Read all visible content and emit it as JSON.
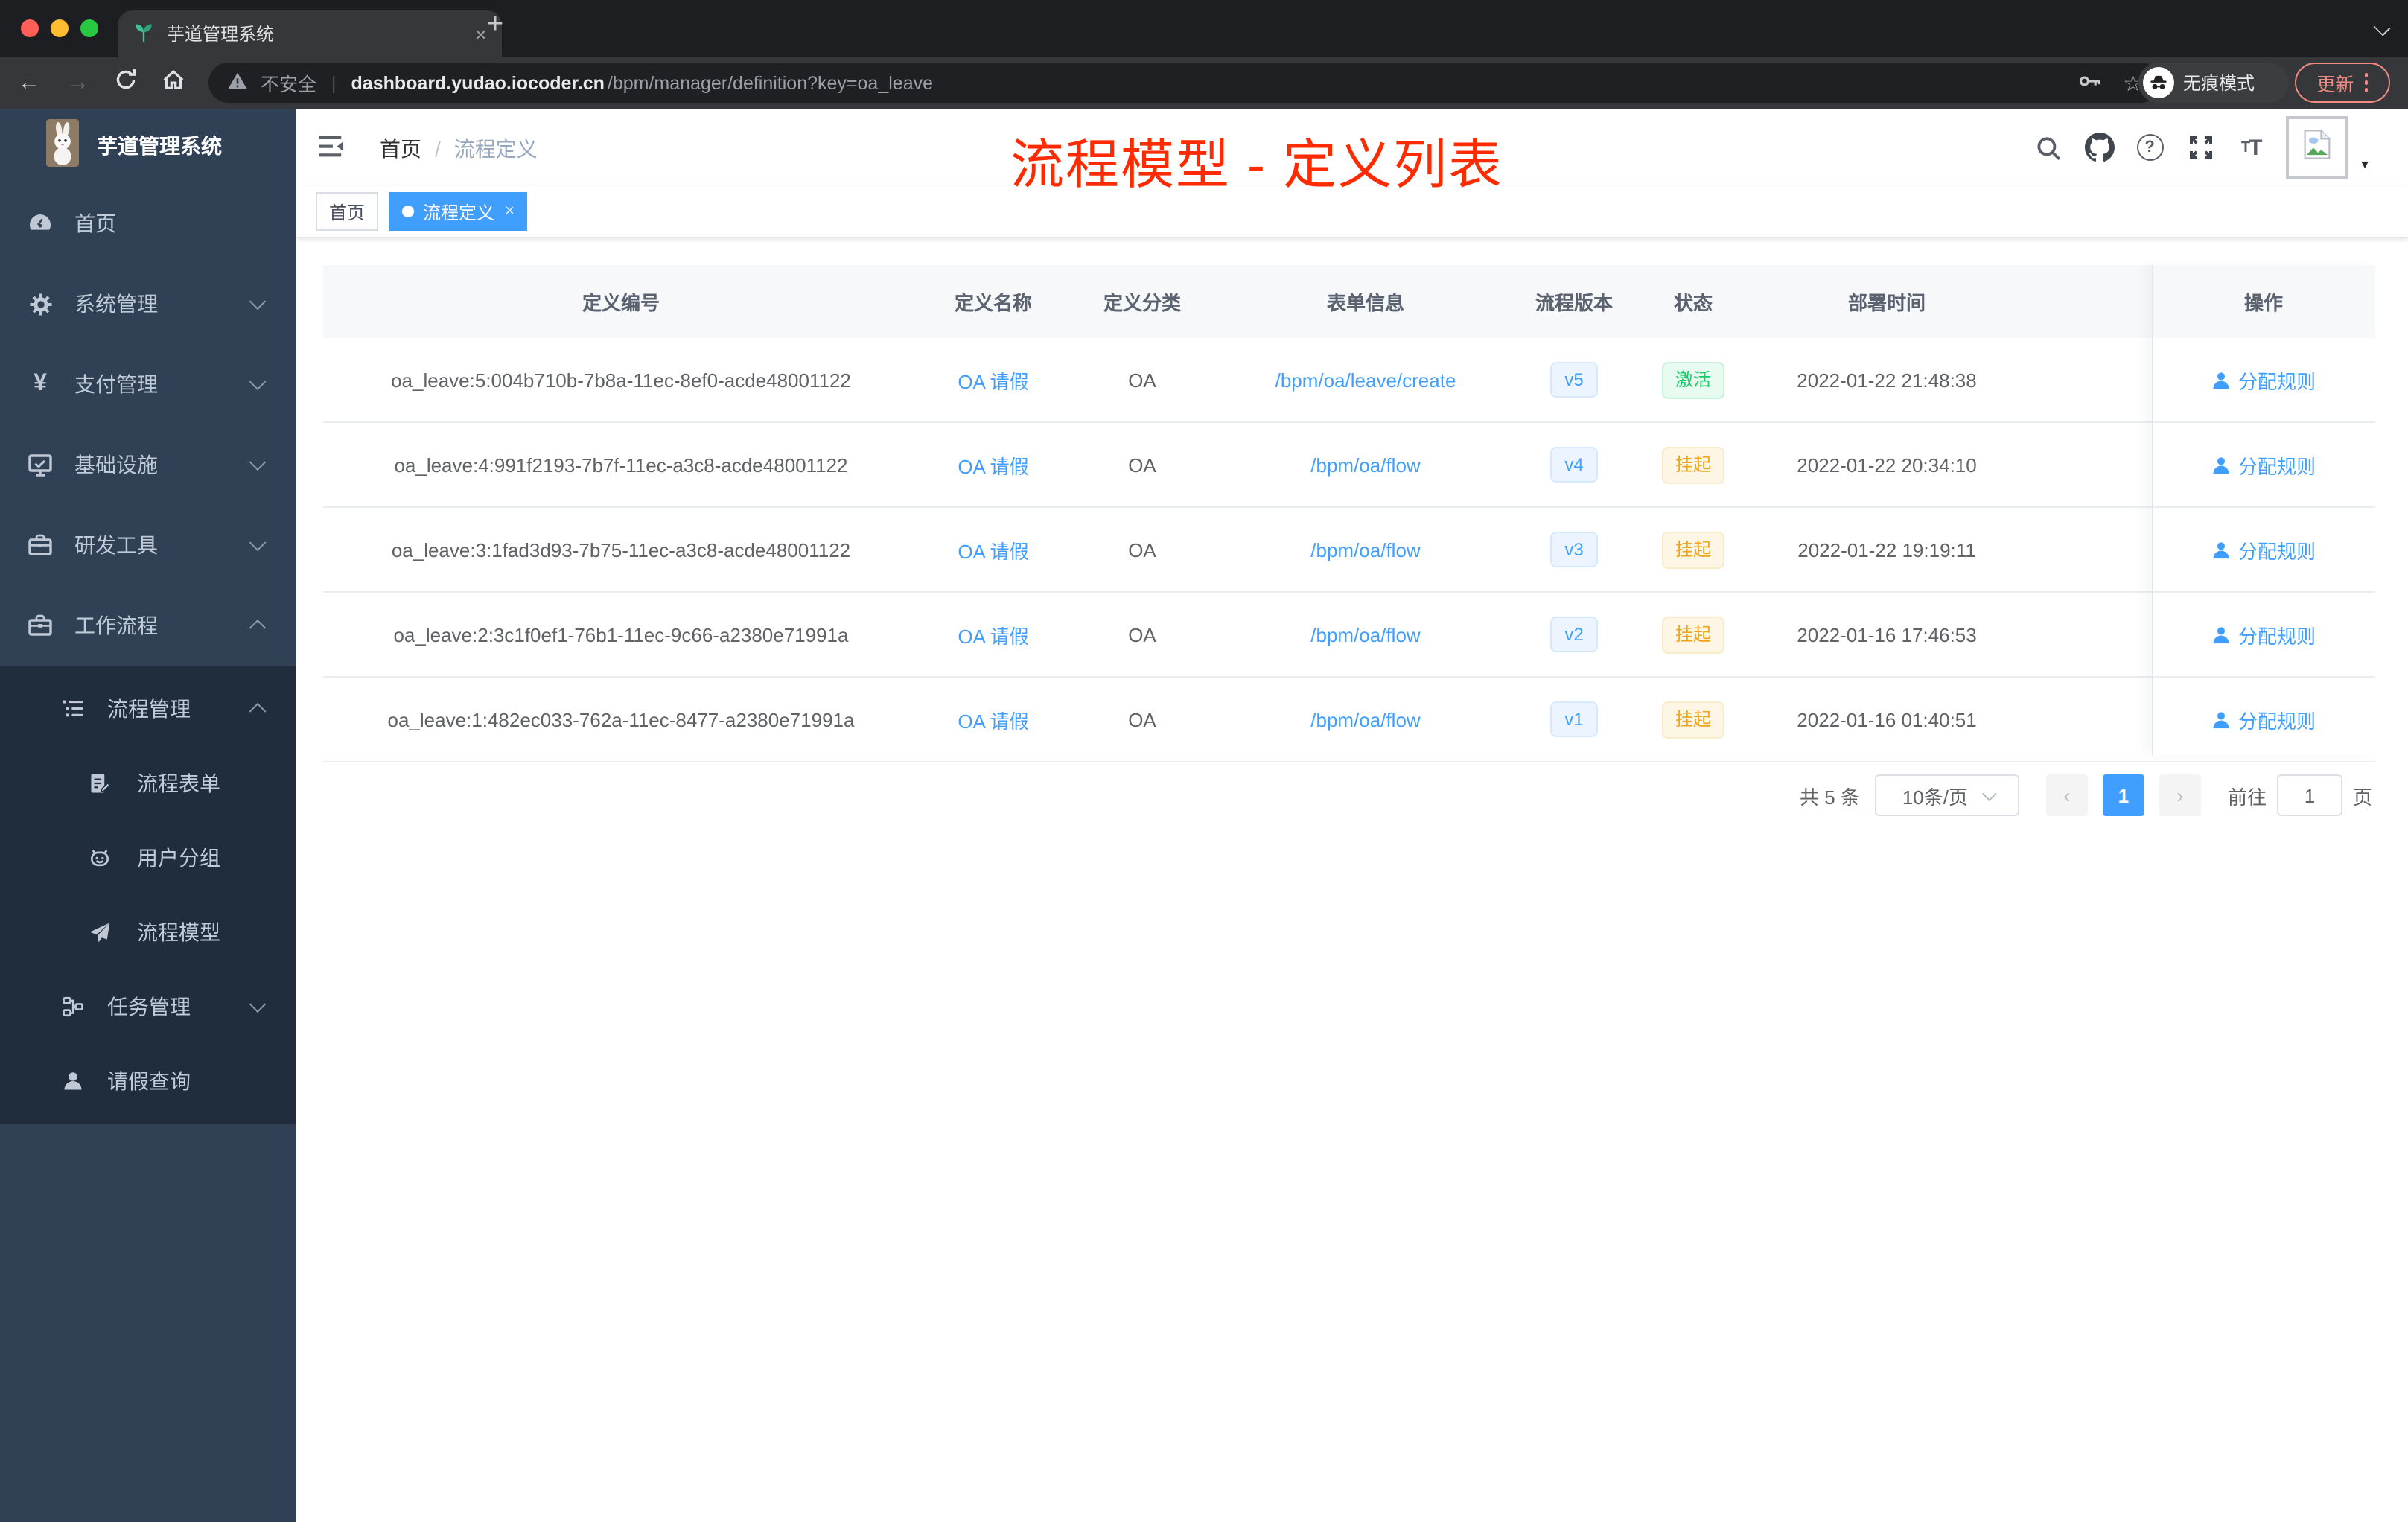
{
  "browser": {
    "tab_title": "芋道管理系统",
    "security_label": "不安全",
    "url_domain": "dashboard.yudao.iocoder.cn",
    "url_path": "/bpm/manager/definition?key=oa_leave",
    "incognito_label": "无痕模式",
    "update_label": "更新"
  },
  "glyphs": {
    "close": "×",
    "plus": "+",
    "back": "←",
    "forward": "→",
    "star": "☆",
    "caret_down": "▼",
    "prev": "‹",
    "next": "›",
    "help": "?",
    "slash": "/",
    "divider": "|",
    "font_size_small": "T",
    "font_size_big": "T"
  },
  "header": {
    "breadcrumb_home": "首页",
    "breadcrumb_current": "流程定义",
    "annotation": "流程模型 - 定义列表"
  },
  "tags": [
    {
      "label": "首页",
      "active": false
    },
    {
      "label": "流程定义",
      "active": true
    }
  ],
  "sidebar": {
    "logo_title": "芋道管理系统",
    "items": [
      {
        "label": "首页"
      },
      {
        "label": "系统管理"
      },
      {
        "label": "支付管理"
      },
      {
        "label": "基础设施"
      },
      {
        "label": "研发工具"
      },
      {
        "label": "工作流程"
      },
      {
        "label": "流程管理"
      },
      {
        "label": "流程表单"
      },
      {
        "label": "用户分组"
      },
      {
        "label": "流程模型"
      },
      {
        "label": "任务管理"
      },
      {
        "label": "请假查询"
      }
    ]
  },
  "table": {
    "headers": [
      "定义编号",
      "定义名称",
      "定义分类",
      "表单信息",
      "流程版本",
      "状态",
      "部署时间",
      "操作"
    ],
    "rows": [
      {
        "id": "oa_leave:5:004b710b-7b8a-11ec-8ef0-acde48001122",
        "name": "OA 请假",
        "category": "OA",
        "form": "/bpm/oa/leave/create",
        "version": "v5",
        "status": "激活",
        "status_type": "success",
        "time": "2022-01-22 21:48:38",
        "action": "分配规则"
      },
      {
        "id": "oa_leave:4:991f2193-7b7f-11ec-a3c8-acde48001122",
        "name": "OA 请假",
        "category": "OA",
        "form": "/bpm/oa/flow",
        "version": "v4",
        "status": "挂起",
        "status_type": "warning",
        "time": "2022-01-22 20:34:10",
        "action": "分配规则"
      },
      {
        "id": "oa_leave:3:1fad3d93-7b75-11ec-a3c8-acde48001122",
        "name": "OA 请假",
        "category": "OA",
        "form": "/bpm/oa/flow",
        "version": "v3",
        "status": "挂起",
        "status_type": "warning",
        "time": "2022-01-22 19:19:11",
        "action": "分配规则"
      },
      {
        "id": "oa_leave:2:3c1f0ef1-76b1-11ec-9c66-a2380e71991a",
        "name": "OA 请假",
        "category": "OA",
        "form": "/bpm/oa/flow",
        "version": "v2",
        "status": "挂起",
        "status_type": "warning",
        "time": "2022-01-16 17:46:53",
        "action": "分配规则"
      },
      {
        "id": "oa_leave:1:482ec033-762a-11ec-8477-a2380e71991a",
        "name": "OA 请假",
        "category": "OA",
        "form": "/bpm/oa/flow",
        "version": "v1",
        "status": "挂起",
        "status_type": "warning",
        "time": "2022-01-16 01:40:51",
        "action": "分配规则"
      }
    ]
  },
  "pagination": {
    "total": "共 5 条",
    "page_size": "10条/页",
    "current_page": "1",
    "goto_label": "前往",
    "goto_value": "1",
    "page_unit": "页"
  },
  "colors": {
    "accent": "#409eff",
    "success": "#13ce66",
    "warning": "#efa41d",
    "annotation_red": "#fe2b00",
    "sidebar_bg": "#304156",
    "submenu_bg": "#1f2d3d",
    "update_red": "#f28b82"
  }
}
